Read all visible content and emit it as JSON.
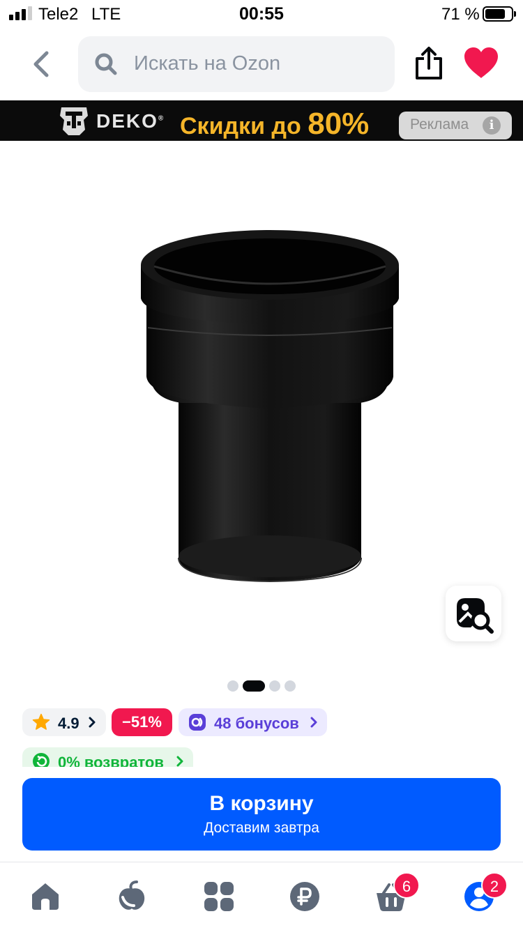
{
  "status_bar": {
    "carrier": "Tele2",
    "network": "LTE",
    "time": "00:55",
    "battery": "71 %"
  },
  "header": {
    "search_placeholder": "Искать на Ozon"
  },
  "banner": {
    "brand": "DEKO",
    "trademark": "®",
    "sale_text": "Скидки до ",
    "sale_pct": "80%",
    "ad_label": "Реклама",
    "info": "i"
  },
  "product": {
    "image": "product-photo",
    "gallery_count": 4,
    "gallery_active": 1
  },
  "chips": {
    "rating": "4.9",
    "discount": "−51%",
    "bonus": "48 бонусов",
    "returns": "0% возвратов"
  },
  "cart": {
    "label": "В корзину",
    "sublabel": "Доставим завтра"
  },
  "tabbar": {
    "cart_badge": "6",
    "profile_badge": "2"
  },
  "colors": {
    "accent": "#005bff",
    "discount": "#f1184f",
    "bonus": "#5a3fd8",
    "returns": "#10b53a"
  }
}
